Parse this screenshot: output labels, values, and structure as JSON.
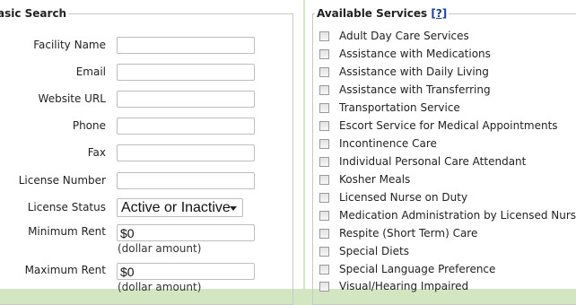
{
  "basic_search": {
    "legend": "asic Search",
    "fields": [
      {
        "label": "Facility Name",
        "value": ""
      },
      {
        "label": "Email",
        "value": ""
      },
      {
        "label": "Website URL",
        "value": ""
      },
      {
        "label": "Phone",
        "value": ""
      },
      {
        "label": "Fax",
        "value": ""
      },
      {
        "label": "License Number",
        "value": ""
      }
    ],
    "license_status": {
      "label": "License Status",
      "selected": "Active or Inactive"
    },
    "minimum_rent": {
      "label": "Minimum Rent",
      "value": "$0",
      "hint": "(dollar amount)"
    },
    "maximum_rent": {
      "label": "Maximum Rent",
      "value": "$0",
      "hint": "(dollar amount)"
    }
  },
  "available_services": {
    "legend": "Available Services",
    "help_link": "[?]",
    "items": [
      "Adult Day Care Services",
      "Assistance with Medications",
      "Assistance with Daily Living",
      "Assistance with Transferring",
      "Transportation Service",
      "Escort Service for Medical Appointments",
      "Incontinence Care",
      "Individual Personal Care Attendant",
      "Kosher Meals",
      "Licensed Nurse on Duty",
      "Medication Administration by Licensed Nurse",
      "Respite (Short Term) Care",
      "Special Diets",
      "Special Language Preference",
      "Visual/Hearing Impaired"
    ]
  },
  "colors": {
    "page_background": "#d3e6c2",
    "panel": "#ffffff",
    "link": "#1a3e99"
  }
}
